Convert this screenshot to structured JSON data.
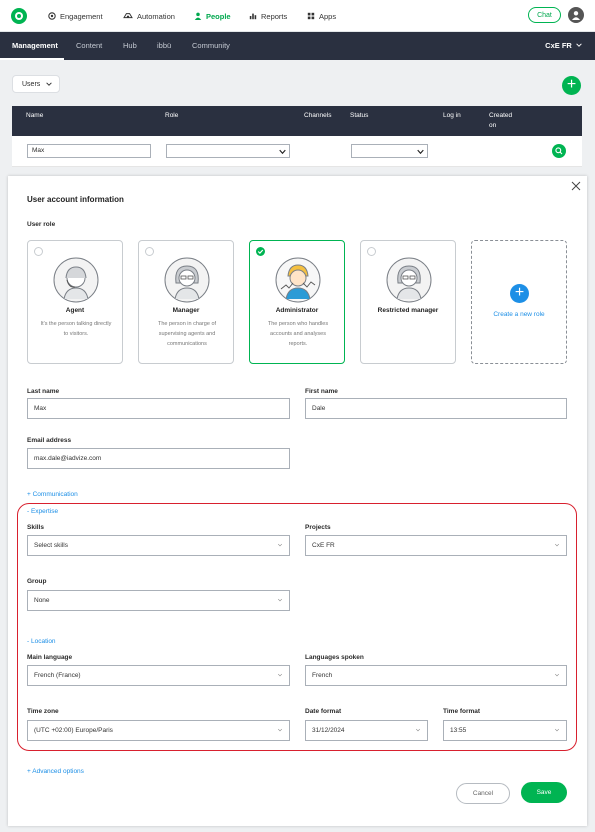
{
  "topnav": {
    "items": [
      {
        "label": "Engagement",
        "icon": "engagement-icon"
      },
      {
        "label": "Automation",
        "icon": "automation-icon"
      },
      {
        "label": "People",
        "icon": "people-icon",
        "active": true
      },
      {
        "label": "Reports",
        "icon": "reports-icon"
      },
      {
        "label": "Apps",
        "icon": "apps-icon"
      }
    ],
    "chat_label": "Chat"
  },
  "subnav": {
    "items": [
      {
        "label": "Management",
        "active": true
      },
      {
        "label": "Content"
      },
      {
        "label": "Hub"
      },
      {
        "label": "ibbü"
      },
      {
        "label": "Community"
      }
    ],
    "workspace": "CxE FR"
  },
  "users_dropdown": "Users",
  "table": {
    "headers": [
      "Name",
      "Role",
      "Channels",
      "Status",
      "Log in",
      "Created on"
    ],
    "filter_name": "Max"
  },
  "panel": {
    "title": "User account information",
    "user_role_label": "User role",
    "roles": [
      {
        "name": "Agent",
        "desc": "It's the person talking directly to visitors.",
        "selected": false
      },
      {
        "name": "Manager",
        "desc": "The person in charge of supervising agents and communications",
        "selected": false
      },
      {
        "name": "Administrator",
        "desc": "The person who handles accounts and analyses reports.",
        "selected": true
      },
      {
        "name": "Restricted manager",
        "desc": "",
        "selected": false
      }
    ],
    "create_role": "Create a new role",
    "last_name_label": "Last name",
    "last_name": "Max",
    "first_name_label": "First name",
    "first_name": "Dale",
    "email_label": "Email address",
    "email": "max.dale@iadvize.com",
    "communication_link": "+ Communication",
    "expertise_link": "- Expertise",
    "skills_label": "Skills",
    "skills_placeholder": "Select skills",
    "projects_label": "Projects",
    "projects_value": "CxE FR",
    "group_label": "Group",
    "group_value": "None",
    "location_link": "- Location",
    "main_language_label": "Main language",
    "main_language": "French (France)",
    "languages_spoken_label": "Languages spoken",
    "languages_spoken": "French",
    "timezone_label": "Time zone",
    "timezone": "(UTC +02:00) Europe/Paris",
    "date_format_label": "Date format",
    "date_format": "31/12/2024",
    "time_format_label": "Time format",
    "time_format": "13:55",
    "advanced_link": "+ Advanced options",
    "cancel": "Cancel",
    "save": "Save"
  },
  "colors": {
    "accent": "#00b452",
    "navbar": "#2a3040",
    "link": "#1d8fe6",
    "highlight": "#d8202e"
  }
}
